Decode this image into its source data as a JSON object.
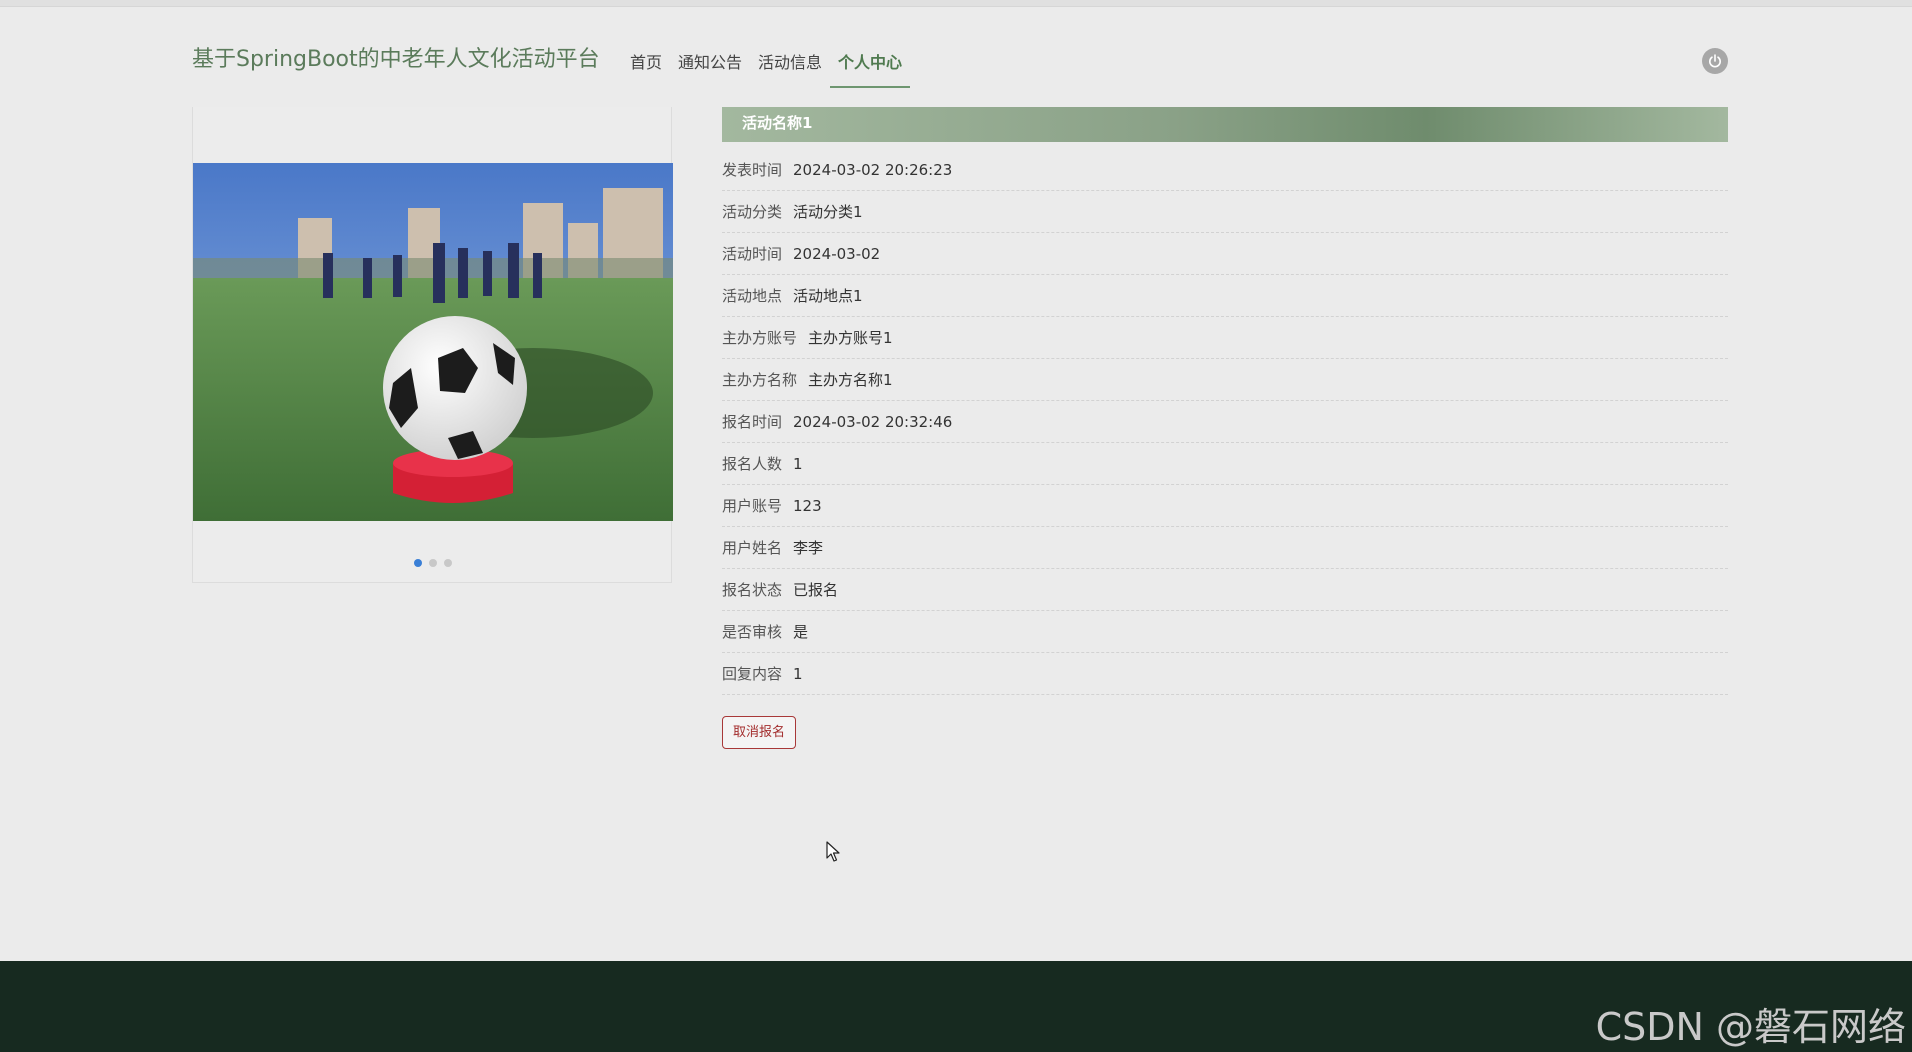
{
  "header": {
    "brand": "基于SpringBoot的中老年人文化活动平台",
    "nav": [
      {
        "label": "首页",
        "active": false
      },
      {
        "label": "通知公告",
        "active": false
      },
      {
        "label": "活动信息",
        "active": false
      },
      {
        "label": "个人中心",
        "active": true
      }
    ],
    "power_icon": "power-icon"
  },
  "carousel": {
    "slide_count": 3,
    "active_index": 0
  },
  "detail": {
    "title": "活动名称1",
    "rows": [
      {
        "label": "发表时间",
        "value": "2024-03-02 20:26:23"
      },
      {
        "label": "活动分类",
        "value": "活动分类1"
      },
      {
        "label": "活动时间",
        "value": "2024-03-02"
      },
      {
        "label": "活动地点",
        "value": "活动地点1"
      },
      {
        "label": "主办方账号",
        "value": "主办方账号1"
      },
      {
        "label": "主办方名称",
        "value": "主办方名称1"
      },
      {
        "label": "报名时间",
        "value": "2024-03-02 20:32:46"
      },
      {
        "label": "报名人数",
        "value": "1"
      },
      {
        "label": "用户账号",
        "value": "123"
      },
      {
        "label": "用户姓名",
        "value": "李李"
      },
      {
        "label": "报名状态",
        "value": "已报名"
      },
      {
        "label": "是否审核",
        "value": "是"
      },
      {
        "label": "回复内容",
        "value": "1"
      }
    ],
    "cancel_label": "取消报名"
  },
  "footer": {
    "watermark": "CSDN @磐石网络"
  },
  "colors": {
    "brand": "#5b7b5b",
    "title_bar": "#8aa187",
    "footer": "#172a20",
    "cancel": "#a32d2d",
    "dot_active": "#3a7fd6"
  }
}
